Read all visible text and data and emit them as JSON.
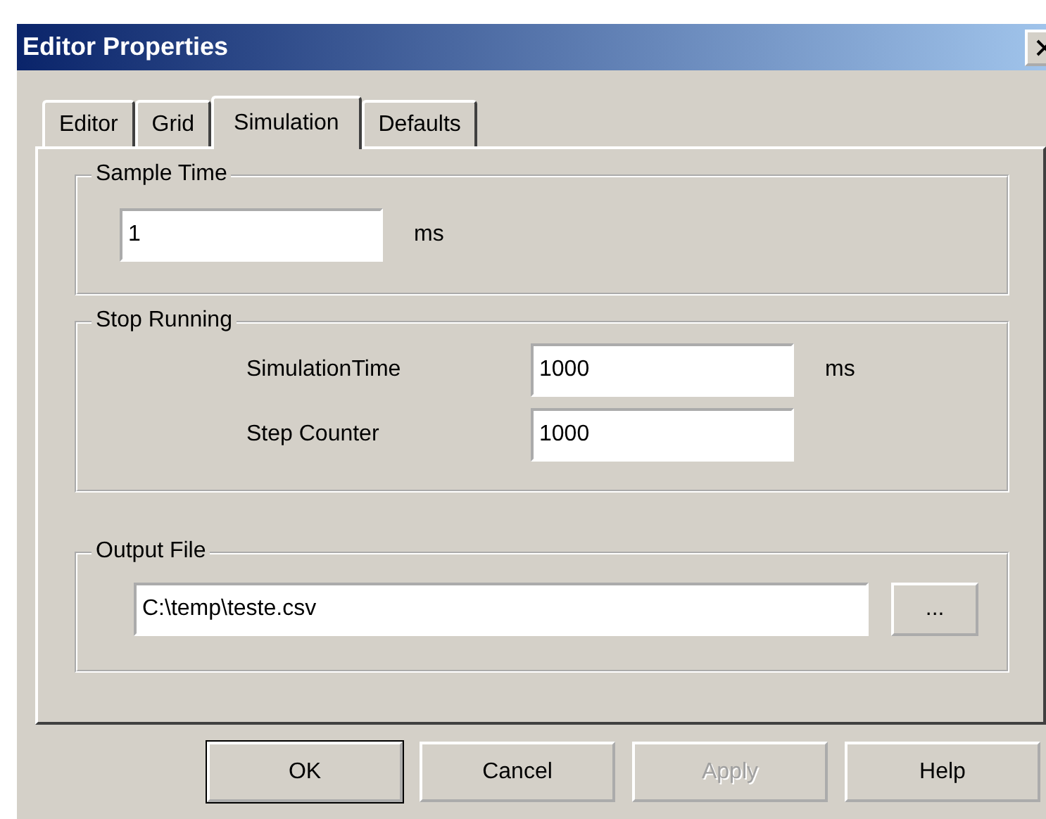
{
  "window": {
    "title": "Editor Properties"
  },
  "tabs": [
    {
      "label": "Editor",
      "selected": false
    },
    {
      "label": "Grid",
      "selected": false
    },
    {
      "label": "Simulation",
      "selected": true
    },
    {
      "label": "Defaults",
      "selected": false
    }
  ],
  "groups": [
    {
      "kind": "plain",
      "title": "Sample Time",
      "rows": [
        {
          "value": "1",
          "unit": "ms"
        }
      ]
    },
    {
      "kind": "labeled",
      "title": "Stop Running",
      "rows": [
        {
          "label": "SimulationTime",
          "value": "1000",
          "unit": "ms"
        },
        {
          "label": "Step Counter",
          "value": "1000"
        }
      ]
    },
    {
      "kind": "file",
      "title": "Output File",
      "rows": [
        {
          "value": "C:\\temp\\teste.csv"
        }
      ],
      "browse_button": "..."
    }
  ],
  "buttons": [
    {
      "label": "OK",
      "default": true,
      "disabled": false
    },
    {
      "label": "Cancel",
      "default": false,
      "disabled": false
    },
    {
      "label": "Apply",
      "default": false,
      "disabled": true
    },
    {
      "label": "Help",
      "default": false,
      "disabled": false
    }
  ]
}
